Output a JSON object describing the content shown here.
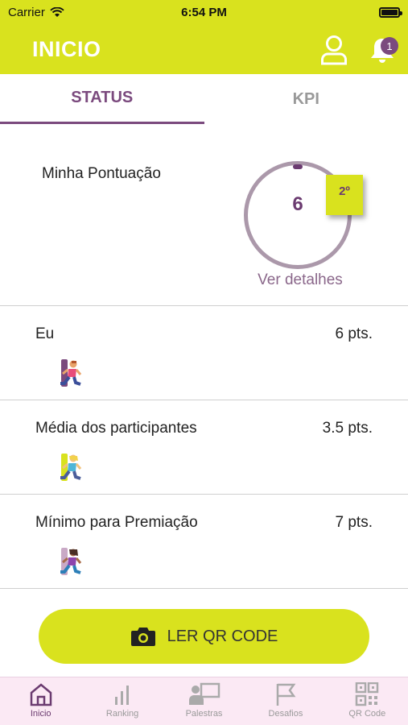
{
  "status_bar": {
    "carrier": "Carrier",
    "time": "6:54 PM"
  },
  "header": {
    "title": "INICIO",
    "notification_count": "1"
  },
  "tabs": [
    {
      "label": "STATUS",
      "active": true
    },
    {
      "label": "KPI",
      "active": false
    }
  ],
  "score": {
    "label": "Minha Pontuação",
    "value": "6",
    "rank": "2º",
    "details_link": "Ver detalhes"
  },
  "rows": [
    {
      "label": "Eu",
      "value": "6 pts.",
      "bar_color": "#7b4a7e",
      "runner_icon": "runner-pink-icon"
    },
    {
      "label": "Média dos participantes",
      "value": "3.5 pts.",
      "bar_color": "#d9e21e",
      "runner_icon": "runner-blonde-icon"
    },
    {
      "label": "Mínimo para Premiação",
      "value": "7 pts.",
      "bar_color": "#c9a9c6",
      "runner_icon": "runner-purple-icon"
    }
  ],
  "scan_button": {
    "label": "LER QR CODE",
    "icon": "camera-icon"
  },
  "tabbar": [
    {
      "label": "Inicio",
      "icon": "home-icon",
      "active": true
    },
    {
      "label": "Ranking",
      "icon": "bar-chart-icon",
      "active": false
    },
    {
      "label": "Palestras",
      "icon": "presentation-icon",
      "active": false
    },
    {
      "label": "Desafios",
      "icon": "flag-icon",
      "active": false
    },
    {
      "label": "QR Code",
      "icon": "qr-code-icon",
      "active": false
    }
  ],
  "colors": {
    "accent": "#d9e21e",
    "brand_purple": "#7b4a7e",
    "ring": "#ab98aa",
    "tabbar_bg": "#fbe9f4"
  }
}
